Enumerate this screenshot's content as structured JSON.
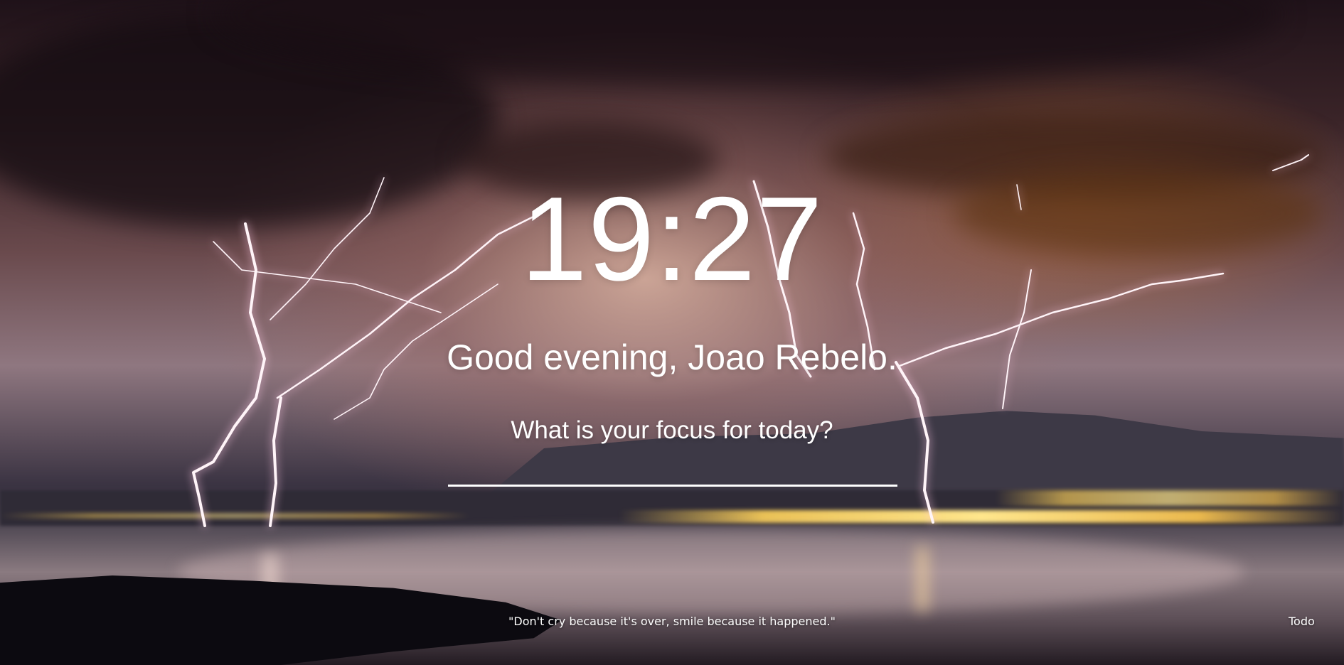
{
  "clock": {
    "time": "19:27"
  },
  "greeting": {
    "text": "Good evening, Joao Rebelo."
  },
  "focus": {
    "question": "What is your focus for today?",
    "value": ""
  },
  "footer": {
    "quote": "\"Don't cry because it's over, smile because it happened.\"",
    "todo_label": "Todo"
  },
  "background": {
    "subject": "lightning-storm-over-lake"
  },
  "colors": {
    "text": "#ffffff"
  }
}
